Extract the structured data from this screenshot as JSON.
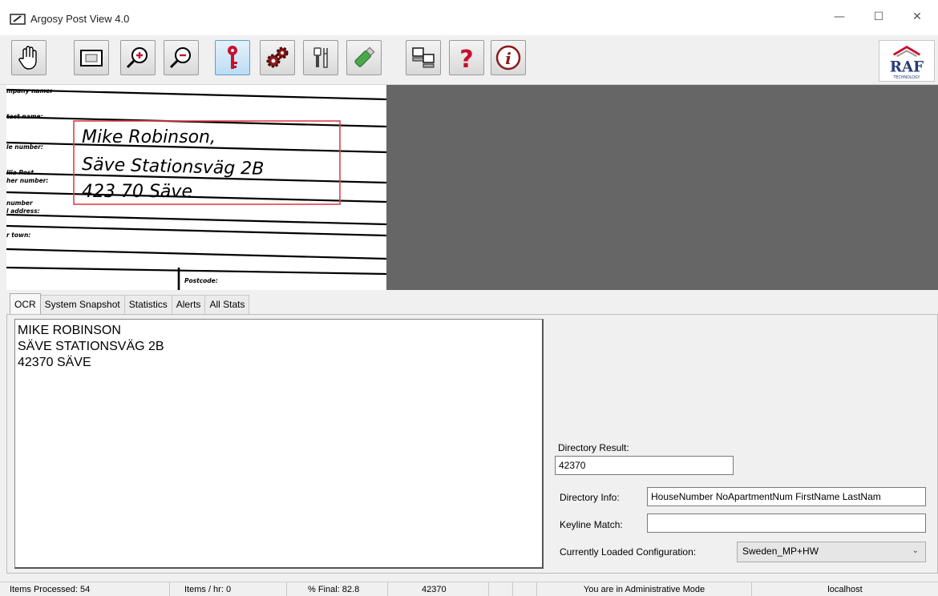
{
  "window": {
    "title": "Argosy Post View 4.0",
    "minimize": "—",
    "maximize": "☐",
    "close": "✕"
  },
  "toolbar": {
    "buttons": [
      {
        "icon": "hand-icon",
        "active": false
      },
      {
        "icon": "image-view-icon",
        "active": false
      },
      {
        "icon": "zoom-in-icon",
        "active": false
      },
      {
        "icon": "zoom-out-icon",
        "active": false
      },
      {
        "icon": "key-icon",
        "active": true
      },
      {
        "icon": "gears-icon",
        "active": false
      },
      {
        "icon": "tools-icon",
        "active": false
      },
      {
        "icon": "usb-drive-icon",
        "active": false
      },
      {
        "icon": "computers-icon",
        "active": false
      },
      {
        "icon": "help-icon",
        "active": false
      },
      {
        "icon": "info-icon",
        "active": false
      }
    ],
    "logo_text": "RAF",
    "logo_subtext": "TECHNOLOGY"
  },
  "form_image": {
    "labels": [
      "mpany name:",
      "tact name:",
      "le number:",
      "llia Post",
      "her number:",
      "number",
      "l address:",
      "r town:",
      "Postcode:"
    ],
    "handwriting": [
      "Mike Robinson,",
      "Säve Stationsväg 2B",
      "423 70 Säve"
    ]
  },
  "tabs": [
    "OCR",
    "System Snapshot",
    "Statistics",
    "Alerts",
    "All Stats"
  ],
  "ocr": {
    "lines": [
      "MIKE ROBINSON",
      "SÄVE STATIONSVÄG 2B",
      "42370 SÄVE"
    ]
  },
  "directory": {
    "result_label": "Directory Result:",
    "result_value": "42370",
    "info_label": "Directory Info:",
    "info_value": "HouseNumber NoApartmentNum FirstName LastNam",
    "keyline_label": "Keyline Match:",
    "keyline_value": "",
    "config_label": "Currently Loaded Configuration:",
    "config_value": "Sweden_MP+HW"
  },
  "status": {
    "items_processed": "Items Processed: 54",
    "items_hr": "Items / hr: 0",
    "final": "% Final: 82.8",
    "code": "42370",
    "blank1": "",
    "blank2": "",
    "mode": "You are in Administrative Mode",
    "host": "localhost"
  },
  "colors": {
    "accent": "#2b8fd9",
    "key_red": "#c8102e",
    "pane_grey": "#666666",
    "bbox_red": "#e0404a"
  }
}
